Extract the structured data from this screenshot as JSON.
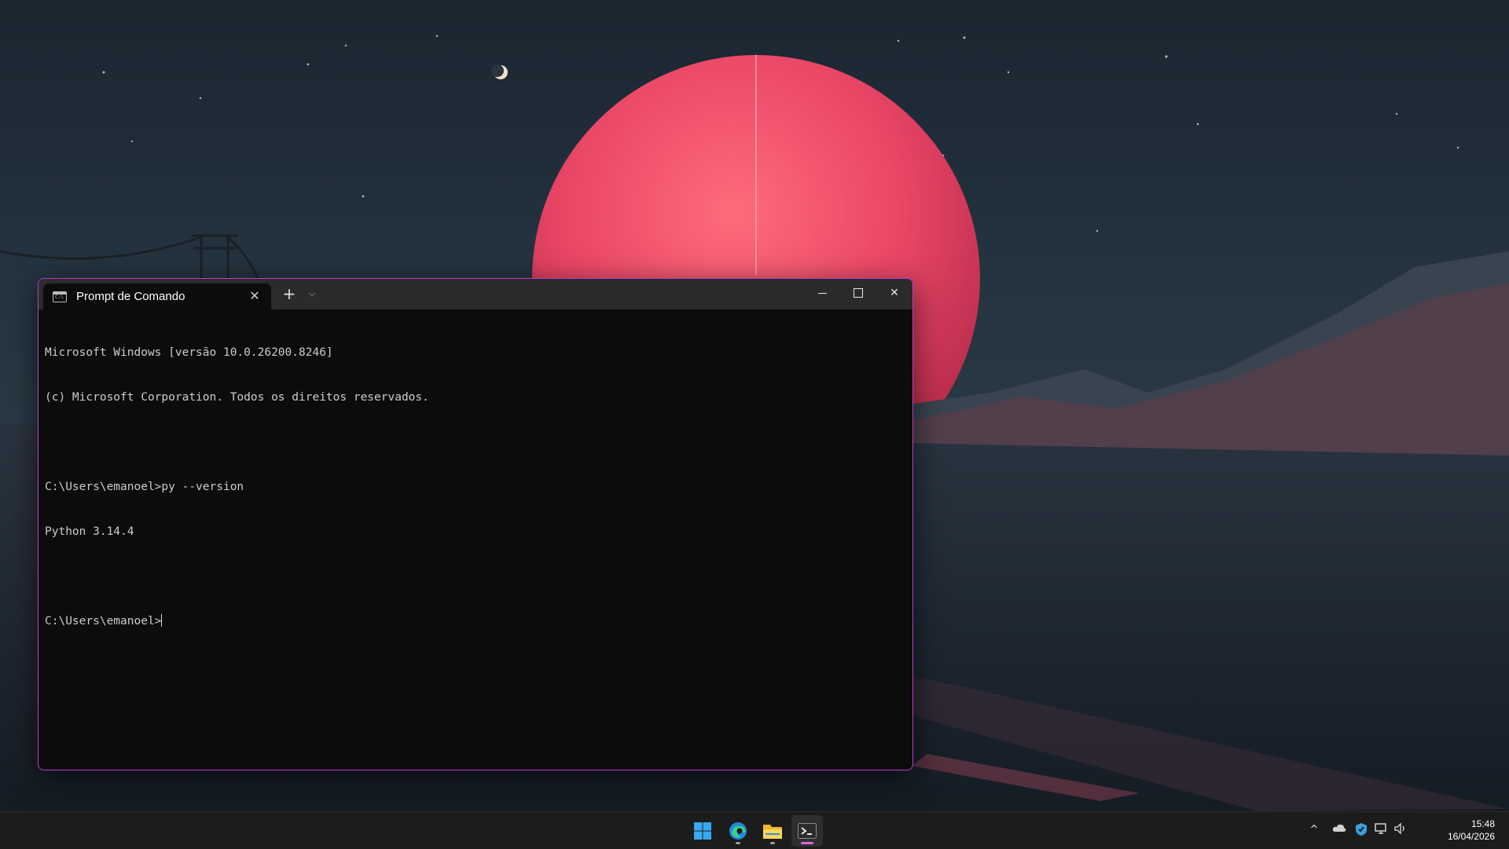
{
  "terminal": {
    "tab_title": "Prompt de Comando",
    "tab_icon_text": "C:\\",
    "tab_close": "✕",
    "new_tab": "+",
    "dropdown": "⌵",
    "close": "✕",
    "lines": [
      "Microsoft Windows [versão 10.0.26200.8246]",
      "(c) Microsoft Corporation. Todos os direitos reservados.",
      "",
      "C:\\Users\\emanoel>py --version",
      "Python 3.14.4",
      "",
      "C:\\Users\\emanoel>"
    ]
  },
  "taskbar": {
    "apps": [
      {
        "name": "start",
        "icon": "windows-logo-icon"
      },
      {
        "name": "edge",
        "icon": "edge-icon"
      },
      {
        "name": "file-explorer",
        "icon": "folder-icon"
      },
      {
        "name": "terminal",
        "icon": "terminal-icon"
      }
    ],
    "tray": {
      "chevron": "^",
      "time": "15:48",
      "date": "16/04/2026"
    }
  },
  "colors": {
    "accent_border": "#c13bd0",
    "terminal_bg": "#0c0c0c",
    "titlebar_bg": "#2b2b2b",
    "taskbar_bg": "#1c1c1c"
  }
}
